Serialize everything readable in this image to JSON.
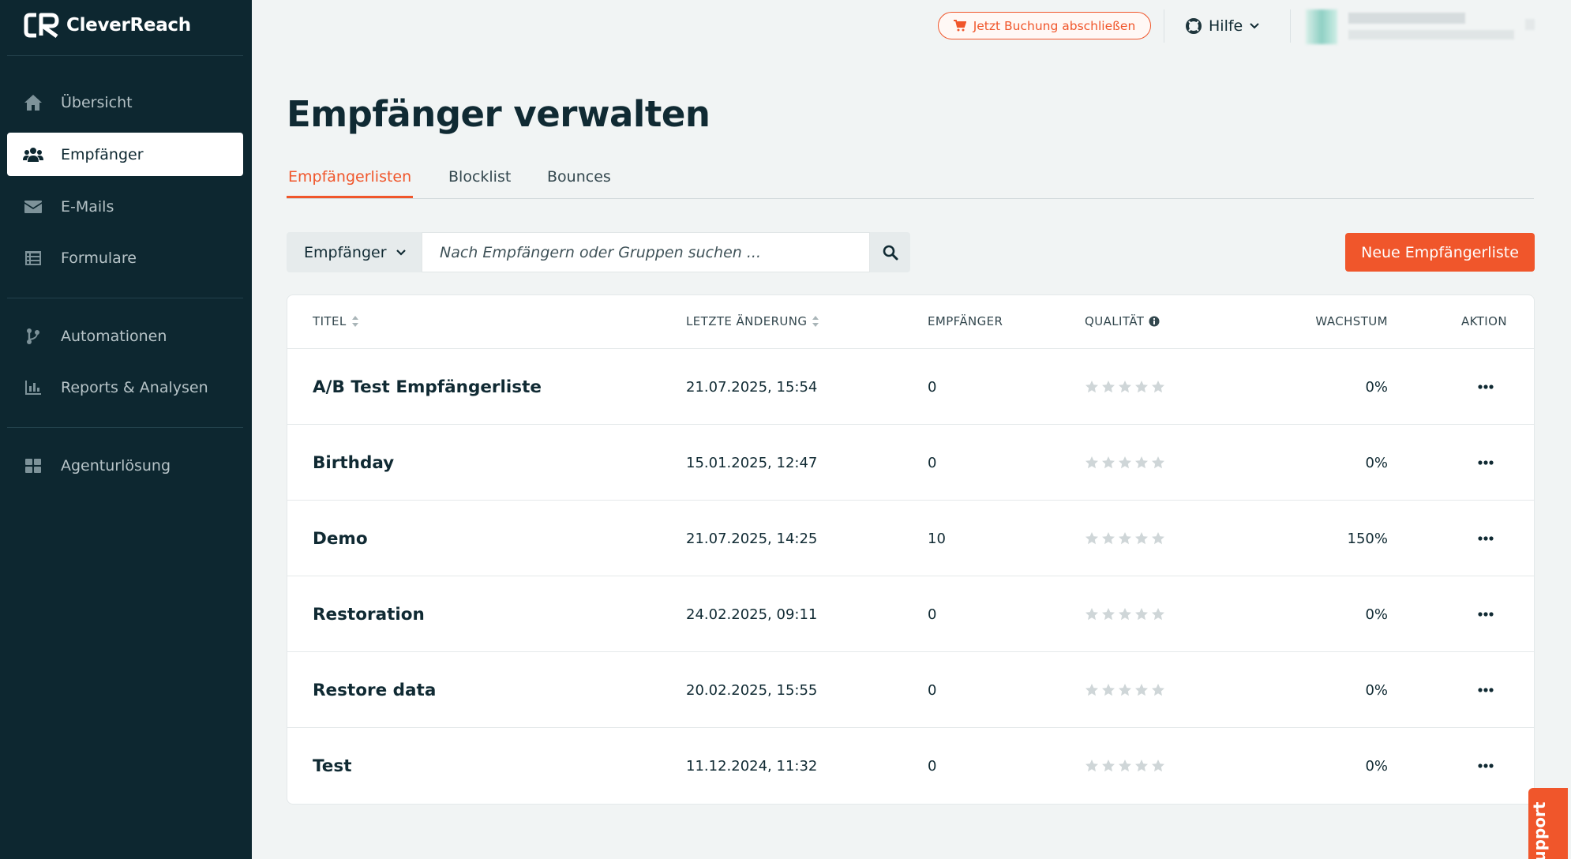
{
  "brand": {
    "name": "CleverReach"
  },
  "sidebar": {
    "items": [
      {
        "label": "Übersicht",
        "icon": "home-icon"
      },
      {
        "label": "Empfänger",
        "icon": "users-icon",
        "active": true
      },
      {
        "label": "E-Mails",
        "icon": "envelope-icon"
      },
      {
        "label": "Formulare",
        "icon": "form-icon"
      },
      {
        "label": "Automationen",
        "icon": "branch-icon"
      },
      {
        "label": "Reports & Analysen",
        "icon": "bar-chart-icon"
      },
      {
        "label": "Agenturlösung",
        "icon": "grid-icon"
      }
    ]
  },
  "topbar": {
    "booking_label": "Jetzt Buchung abschließen",
    "help_label": "Hilfe"
  },
  "page": {
    "title": "Empfänger verwalten",
    "tabs": [
      {
        "label": "Empfängerlisten",
        "active": true
      },
      {
        "label": "Blocklist"
      },
      {
        "label": "Bounces"
      }
    ]
  },
  "search": {
    "filter_label": "Empfänger",
    "placeholder": "Nach Empfängern oder Gruppen suchen ...",
    "new_button": "Neue Empfängerliste"
  },
  "table": {
    "headers": {
      "title": "TITEL",
      "changed": "LETZTE ÄNDERUNG",
      "recipients": "EMPFÄNGER",
      "quality": "QUALITÄT",
      "growth": "WACHSTUM",
      "action": "AKTION"
    },
    "rows": [
      {
        "title": "A/B Test Empfängerliste",
        "changed": "21.07.2025, 15:54",
        "recipients": "0",
        "quality_stars": 0,
        "growth": "0%"
      },
      {
        "title": "Birthday",
        "changed": "15.01.2025, 12:47",
        "recipients": "0",
        "quality_stars": 0,
        "growth": "0%"
      },
      {
        "title": "Demo",
        "changed": "21.07.2025, 14:25",
        "recipients": "10",
        "quality_stars": 0,
        "growth": "150%"
      },
      {
        "title": "Restoration",
        "changed": "24.02.2025, 09:11",
        "recipients": "0",
        "quality_stars": 0,
        "growth": "0%"
      },
      {
        "title": "Restore data",
        "changed": "20.02.2025, 15:55",
        "recipients": "0",
        "quality_stars": 0,
        "growth": "0%"
      },
      {
        "title": "Test",
        "changed": "11.12.2024, 11:32",
        "recipients": "0",
        "quality_stars": 0,
        "growth": "0%"
      }
    ]
  },
  "support": {
    "label": "Support"
  },
  "colors": {
    "sidebar": "#0d2730",
    "accent": "#f0562b",
    "background": "#f1f4f4"
  }
}
